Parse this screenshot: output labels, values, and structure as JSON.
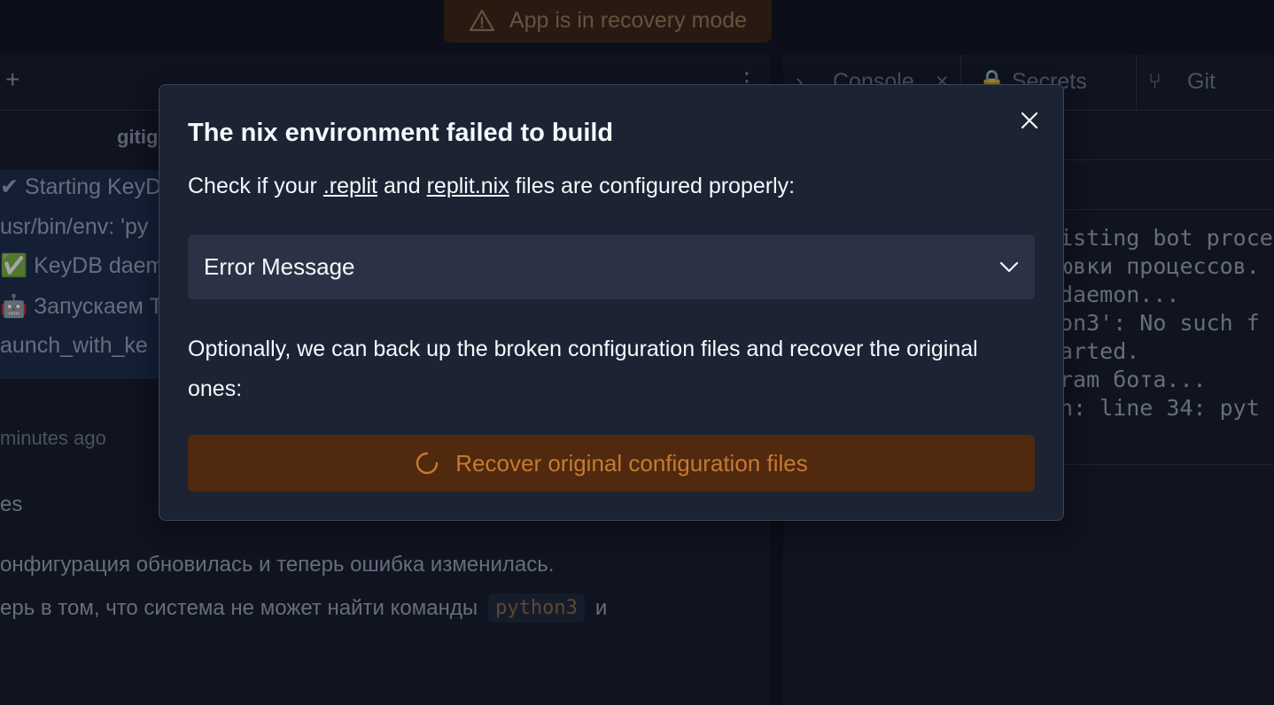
{
  "topbar": {
    "recovery_label": "App is in recovery mode"
  },
  "left_pane": {
    "file_label": "gitig",
    "chat_lines": [
      "✔ Starting KeyD",
      "usr/bin/env: 'py",
      "✅ KeyDB daem",
      "🤖 Запускаем T",
      "aunch_with_ke"
    ],
    "meta": "minutes ago",
    "section_label": "es",
    "message_line1": "онфигурация обновилась и теперь ошибка изменилась.",
    "message_line2_pre": "ерь в том, что система не может найти команды",
    "message_code": "python3",
    "message_line2_post": "и"
  },
  "right_pane": {
    "tabs": [
      {
        "label": "Console"
      },
      {
        "label": "Secrets"
      },
      {
        "label": "Git"
      }
    ],
    "terminal_lines": [
      "isting bot proce",
      "ювки процессов.",
      "daemon...",
      "on3': No such f",
      "arted.",
      "ram бота...",
      "h: line 34: pyt"
    ]
  },
  "modal": {
    "title": "The nix environment failed to build",
    "desc_prefix": "Check if your",
    "link_replit": ".replit",
    "desc_and": "and",
    "link_nix": "replit.nix",
    "desc_suffix": "files are configured properly:",
    "dropdown_label": "Error Message",
    "optional_text": "Optionally, we can back up the broken configuration files and recover the original ones:",
    "recover_label": "Recover original configuration files"
  },
  "colors": {
    "modal_bg": "#1c2333",
    "dropdown_bg": "#2b3245",
    "recover_bg": "#50290e",
    "recover_text": "#c57a32",
    "warning_text": "#9a7a55"
  }
}
